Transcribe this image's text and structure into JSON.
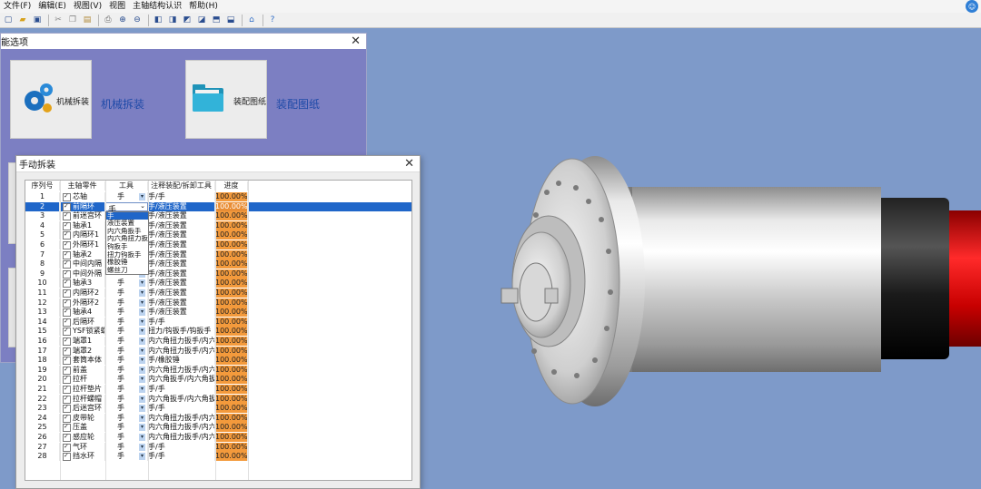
{
  "menu": [
    "文件(F)",
    "编辑(E)",
    "视图(V)",
    "视图",
    "主轴结构认识",
    "帮助(H)"
  ],
  "toolbar_icons": [
    "new-file-icon",
    "open-folder-icon",
    "save-icon",
    "cut-icon",
    "copy-icon",
    "paste-icon",
    "print-icon",
    "zoom-in-icon",
    "zoom-out-icon",
    "view-front-icon",
    "view-back-icon",
    "view-left-icon",
    "view-right-icon",
    "view-top-icon",
    "view-bottom-icon",
    "home-icon",
    "help-icon"
  ],
  "options_window": {
    "title": "能选项",
    "tiles": [
      {
        "small": "机械拆装",
        "big": "机械拆装",
        "icon": "gears-icon"
      },
      {
        "small": "装配图纸",
        "big": "装配图纸",
        "icon": "folder-icon"
      }
    ]
  },
  "manual_dialog": {
    "title": "手动拆装",
    "columns": [
      "序列号",
      "主轴零件",
      "工具",
      "注释装配/拆卸工具",
      "进度"
    ],
    "rows": [
      {
        "id": "1",
        "part": "芯轴",
        "tool": "手",
        "note": "手/手",
        "progress": "100.00%"
      },
      {
        "id": "2",
        "part": "前隔环",
        "tool": "手",
        "note": "手/液压装置",
        "progress": "100.00%"
      },
      {
        "id": "3",
        "part": "前迷宫环",
        "tool": "",
        "note": "手/液压装置",
        "progress": "100.00%"
      },
      {
        "id": "4",
        "part": "轴承1",
        "tool": "",
        "note": "手/液压装置",
        "progress": "100.00%"
      },
      {
        "id": "5",
        "part": "内隔环1",
        "tool": "",
        "note": "手/液压装置",
        "progress": "100.00%"
      },
      {
        "id": "6",
        "part": "外隔环1",
        "tool": "",
        "note": "手/液压装置",
        "progress": "100.00%"
      },
      {
        "id": "7",
        "part": "轴承2",
        "tool": "",
        "note": "手/液压装置",
        "progress": "100.00%"
      },
      {
        "id": "8",
        "part": "中间内隔",
        "tool": "",
        "note": "手/液压装置",
        "progress": "100.00%"
      },
      {
        "id": "9",
        "part": "中间外隔",
        "tool": "",
        "note": "手/液压装置",
        "progress": "100.00%"
      },
      {
        "id": "10",
        "part": "轴承3",
        "tool": "手",
        "note": "手/液压装置",
        "progress": "100.00%"
      },
      {
        "id": "11",
        "part": "内隔环2",
        "tool": "手",
        "note": "手/液压装置",
        "progress": "100.00%"
      },
      {
        "id": "12",
        "part": "外隔环2",
        "tool": "手",
        "note": "手/液压装置",
        "progress": "100.00%"
      },
      {
        "id": "13",
        "part": "轴承4",
        "tool": "手",
        "note": "手/液压装置",
        "progress": "100.00%"
      },
      {
        "id": "14",
        "part": "后隔环",
        "tool": "手",
        "note": "手/手",
        "progress": "100.00%"
      },
      {
        "id": "15",
        "part": "YSF锁紧螺",
        "tool": "手",
        "note": "扭力/钩扳手/钩扳手",
        "progress": "100.00%"
      },
      {
        "id": "16",
        "part": "端罩1",
        "tool": "手",
        "note": "内六角扭力扳手/内六",
        "progress": "100.00%"
      },
      {
        "id": "17",
        "part": "端罩2",
        "tool": "手",
        "note": "内六角扭力扳手/内六",
        "progress": "100.00%"
      },
      {
        "id": "18",
        "part": "套筒本体",
        "tool": "手",
        "note": "手/橡胶锤",
        "progress": "100.00%"
      },
      {
        "id": "19",
        "part": "前盖",
        "tool": "手",
        "note": "内六角扭力扳手/内六",
        "progress": "100.00%"
      },
      {
        "id": "20",
        "part": "拉杆",
        "tool": "手",
        "note": "内六角扳手/内六角扳",
        "progress": "100.00%"
      },
      {
        "id": "21",
        "part": "拉杆垫片",
        "tool": "手",
        "note": "手/手",
        "progress": "100.00%"
      },
      {
        "id": "22",
        "part": "拉杆螺帽",
        "tool": "手",
        "note": "内六角扳手/内六角扳",
        "progress": "100.00%"
      },
      {
        "id": "23",
        "part": "后迷宫环",
        "tool": "手",
        "note": "手/手",
        "progress": "100.00%"
      },
      {
        "id": "24",
        "part": "皮带轮",
        "tool": "手",
        "note": "内六角扭力扳手/内六",
        "progress": "100.00%"
      },
      {
        "id": "25",
        "part": "压盖",
        "tool": "手",
        "note": "内六角扭力扳手/内六",
        "progress": "100.00%"
      },
      {
        "id": "26",
        "part": "感应轮",
        "tool": "手",
        "note": "内六角扭力扳手/内六",
        "progress": "100.00%"
      },
      {
        "id": "27",
        "part": "气环",
        "tool": "手",
        "note": "手/手",
        "progress": "100.00%"
      },
      {
        "id": "28",
        "part": "挡水环",
        "tool": "手",
        "note": "手/手",
        "progress": "100.00%"
      }
    ],
    "dropdown_options": [
      "手",
      "液压装置",
      "内六角扳手",
      "内六角扭力扳手",
      "钩扳手",
      "扭力钩扳手",
      "橡胶锤",
      "螺丝刀"
    ],
    "dropdown_highlight": "手"
  },
  "colors": {
    "viewport_bg": "#7e9ac9",
    "options_bg": "#7c7fc2",
    "progress": "#f39a3c",
    "selection": "#1f66c9"
  }
}
